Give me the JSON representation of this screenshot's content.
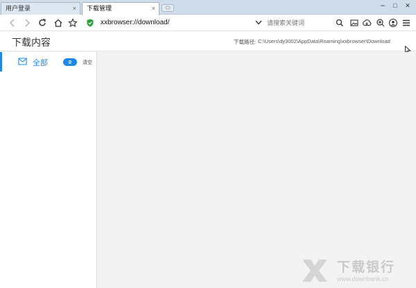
{
  "tabs": [
    {
      "label": "用户登录",
      "active": false
    },
    {
      "label": "下载管理",
      "active": true
    }
  ],
  "tab_close_glyph": "×",
  "window_controls": {
    "minimize": "–",
    "maximize": "□",
    "close": "✕"
  },
  "toolbar": {
    "address": "xxbrowser://download/",
    "search_placeholder": "请搜索关键词"
  },
  "header": {
    "title": "下载内容",
    "path_label": "下载路径:",
    "path_value": "C:\\Users\\dy3002\\AppData\\Roaming\\xxbrowser\\Download"
  },
  "sidebar": {
    "items": [
      {
        "label": "全部",
        "count": "0",
        "icon": "mail-icon"
      }
    ],
    "clear_label": "清空"
  },
  "watermark": {
    "title": "下载银行",
    "url": "www.downbank.cn"
  },
  "colors": {
    "accent": "#1e88e5",
    "secure": "#2ea043",
    "tabstrip": "#cfdcea"
  }
}
